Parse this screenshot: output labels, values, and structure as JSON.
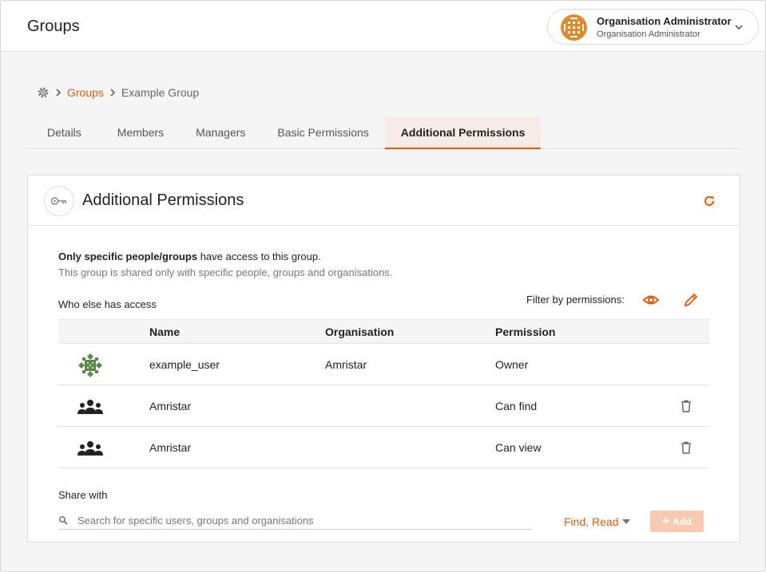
{
  "header": {
    "title": "Groups",
    "account": {
      "name": "Organisation Administrator",
      "role": "Organisation Administrator"
    }
  },
  "breadcrumb": {
    "items": [
      "Groups",
      "Example Group"
    ]
  },
  "tabs": [
    {
      "label": "Details",
      "active": false
    },
    {
      "label": "Members",
      "active": false
    },
    {
      "label": "Managers",
      "active": false
    },
    {
      "label": "Basic Permissions",
      "active": false
    },
    {
      "label": "Additional Permissions",
      "active": true
    }
  ],
  "card": {
    "title": "Additional Permissions",
    "summary_bold": "Only specific people/groups",
    "summary_rest": " have access to this group.",
    "summary_sub": "This group is shared only with specific people, groups and organisations.",
    "who_label": "Who else has access",
    "filter_label": "Filter by permissions:",
    "table": {
      "headers": {
        "name": "Name",
        "organisation": "Organisation",
        "permission": "Permission"
      },
      "rows": [
        {
          "icon": "user-avatar-icon",
          "name": "example_user",
          "organisation": "Amristar",
          "permission": "Owner",
          "deletable": false
        },
        {
          "icon": "group-icon",
          "name": "Amristar",
          "organisation": "",
          "permission": "Can find",
          "deletable": true
        },
        {
          "icon": "group-icon",
          "name": "Amristar",
          "organisation": "",
          "permission": "Can view",
          "deletable": true
        }
      ]
    },
    "share": {
      "label": "Share with",
      "search_placeholder": "Search for specific users, groups and organisations",
      "permission_value": "Find, Read",
      "add_label": "Add"
    }
  },
  "colors": {
    "accent": "#e8590c",
    "add_disabled": "#f9c9b1",
    "avatar_green": "#5a8a4a",
    "avatar_orange": "#e08a2e"
  }
}
